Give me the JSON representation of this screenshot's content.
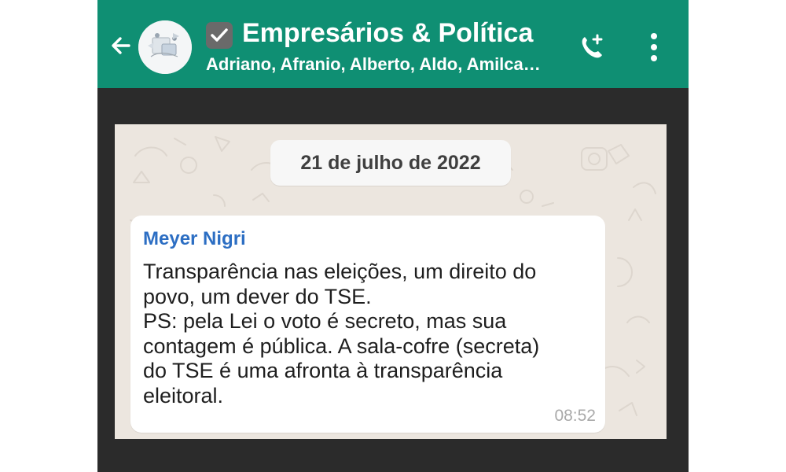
{
  "header": {
    "title": "Empresários & Política",
    "members": "Adriano, Afranio, Alberto, Aldo, Amilca…"
  },
  "chat": {
    "date": "21 de julho de 2022",
    "message": {
      "sender": "Meyer Nigri",
      "text": "Transparência nas eleições, um direito do\npovo, um dever do TSE.\nPS: pela Lei o voto é secreto, mas sua\ncontagem é pública. A sala-cofre (secreta)\ndo TSE é uma afronta à transparência\neleitoral.",
      "time": "08:52"
    }
  },
  "icons": {
    "back": "arrow-left",
    "group_avatar": "group-avatar",
    "verified": "checkmark-box",
    "call": "phone-plus",
    "menu": "more-vertical"
  },
  "colors": {
    "header_green": "#0f8f73",
    "chat_background": "#ece6df",
    "sender_blue": "#2c6ec3",
    "bubble_white": "#ffffff",
    "phone_frame": "#2b2b2b"
  }
}
